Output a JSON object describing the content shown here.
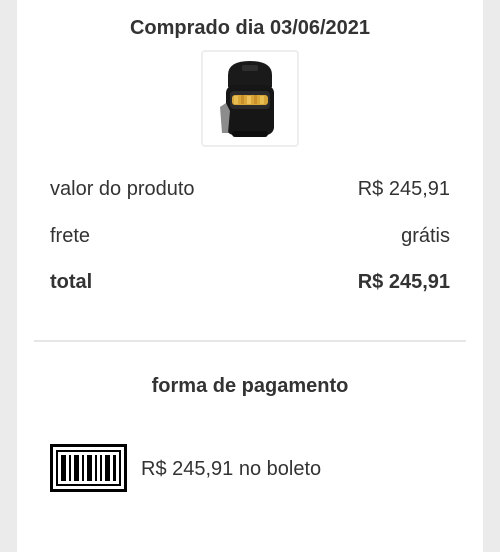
{
  "order": {
    "purchase_date": "Comprado dia 03/06/2021",
    "product_image": "air-fryer-product-image"
  },
  "summary": {
    "rows": [
      {
        "label": "valor do produto",
        "value": "R$ 245,91"
      },
      {
        "label": "frete",
        "value": "grátis"
      },
      {
        "label": "total",
        "value": "R$ 245,91"
      }
    ]
  },
  "payment": {
    "title": "forma de pagamento",
    "icon": "barcode-icon",
    "detail": "R$ 245,91 no boleto"
  }
}
